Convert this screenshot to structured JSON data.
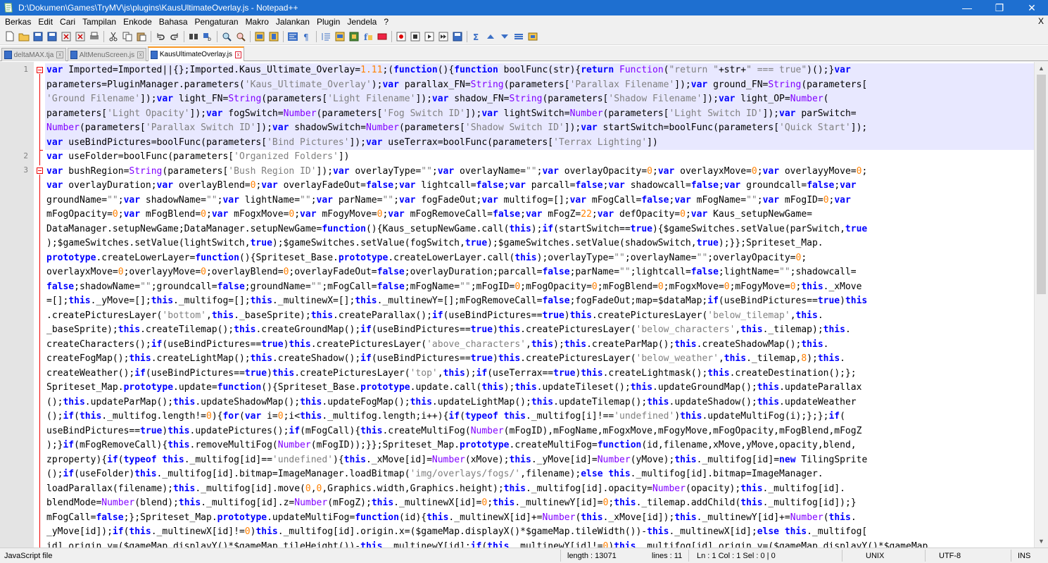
{
  "window": {
    "title": "D:\\Dokumen\\Games\\TryMV\\js\\plugins\\KausUltimateOverlay.js - Notepad++",
    "minimize": "—",
    "maximize": "❐",
    "close": "✕"
  },
  "menu": {
    "items": [
      "Berkas",
      "Edit",
      "Cari",
      "Tampilan",
      "Enkode",
      "Bahasa",
      "Pengaturan",
      "Makro",
      "Jalankan",
      "Plugin",
      "Jendela",
      "?"
    ],
    "close_label": "X"
  },
  "toolbar": {
    "icons": [
      "new-file-icon",
      "open-file-icon",
      "save-icon",
      "save-all-icon",
      "close-file-icon",
      "close-all-icon",
      "print-icon",
      "cut-icon",
      "copy-icon",
      "paste-icon",
      "undo-icon",
      "redo-icon",
      "find-icon",
      "replace-icon",
      "zoom-in-icon",
      "zoom-out-icon",
      "sync-vertical-icon",
      "sync-horizontal-icon",
      "word-wrap-icon",
      "show-all-chars-icon",
      "indent-guide-icon",
      "doc-map-icon",
      "function-list-icon",
      "folder-workspace-icon",
      "monitoring-icon",
      "record-macro-icon",
      "stop-macro-icon",
      "play-macro-icon",
      "run-macro-multiple-icon",
      "save-macro-icon",
      "sigma-icon",
      "up-arrow-icon",
      "down-arrow-icon",
      "compare-icon",
      "plugin-icon"
    ]
  },
  "tabs": [
    {
      "label": "deltaMAX.tja",
      "active": false
    },
    {
      "label": "AltMenuScreen.js",
      "active": false
    },
    {
      "label": "KausUltimateOverlay.js",
      "active": true
    }
  ],
  "editor": {
    "line_numbers": [
      "1",
      "2",
      "3"
    ],
    "code_lines": [
      "var Imported=Imported||{};Imported.Kaus_Ultimate_Overlay=1.11;(function(){function boolFunc(str){return Function(\"return \"+str+\" === true\")();}var",
      "parameters=PluginManager.parameters('Kaus_Ultimate_Overlay');var parallax_FN=String(parameters['Parallax Filename']);var ground_FN=String(parameters[",
      "'Ground Filename']);var light_FN=String(parameters['Light Filename']);var shadow_FN=String(parameters['Shadow Filename']);var light_OP=Number(",
      "parameters['Light Opacity']);var fogSwitch=Number(parameters['Fog Switch ID']);var lightSwitch=Number(parameters['Light Switch ID']);var parSwitch=",
      "Number(parameters['Parallax Switch ID']);var shadowSwitch=Number(parameters['Shadow Switch ID']);var startSwitch=boolFunc(parameters['Quick Start']);",
      "var useBindPictures=boolFunc(parameters['Bind Pictures']);var useTerrax=boolFunc(parameters['Terrax Lighting'])",
      "var useFolder=boolFunc(parameters['Organized Folders'])",
      "var bushRegion=String(parameters['Bush Region ID']);var overlayType=\"\";var overlayName=\"\";var overlayOpacity=0;var overlayxMove=0;var overlayyMove=0;",
      "var overlayDuration;var overlayBlend=0;var overlayFadeOut=false;var lightcall=false;var parcall=false;var shadowcall=false;var groundcall=false;var",
      "groundName=\"\";var shadowName=\"\";var lightName=\"\";var parName=\"\";var fogFadeOut;var multifog=[];var mFogCall=false;var mFogName=\"\";var mFogID=0;var",
      "mFogOpacity=0;var mFogBlend=0;var mFogxMove=0;var mFogyMove=0;var mFogRemoveCall=false;var mFogZ=22;var defOpacity=0;var Kaus_setupNewGame=",
      "DataManager.setupNewGame;DataManager.setupNewGame=function(){Kaus_setupNewGame.call(this);if(startSwitch==true){$gameSwitches.setValue(parSwitch,true",
      ");$gameSwitches.setValue(lightSwitch,true);$gameSwitches.setValue(fogSwitch,true);$gameSwitches.setValue(shadowSwitch,true);}};Spriteset_Map.",
      "prototype.createLowerLayer=function(){Spriteset_Base.prototype.createLowerLayer.call(this);overlayType=\"\";overlayName=\"\";overlayOpacity=0;",
      "overlayxMove=0;overlayyMove=0;overlayBlend=0;overlayFadeOut=false;overlayDuration;parcall=false;parName=\"\";lightcall=false;lightName=\"\";shadowcall=",
      "false;shadowName=\"\";groundcall=false;groundName=\"\";mFogCall=false;mFogName=\"\";mFogID=0;mFogOpacity=0;mFogBlend=0;mFogxMove=0;mFogyMove=0;this._xMove",
      "=[];this._yMove=[];this._multifog=[];this._multinewX=[];this._multinewY=[];mFogRemoveCall=false;fogFadeOut;map=$dataMap;if(useBindPictures==true)this",
      ".createPicturesLayer('bottom',this._baseSprite);this.createParallax();if(useBindPictures==true)this.createPicturesLayer('below_tilemap',this.",
      "_baseSprite);this.createTilemap();this.createGroundMap();if(useBindPictures==true)this.createPicturesLayer('below_characters',this._tilemap);this.",
      "createCharacters();if(useBindPictures==true)this.createPicturesLayer('above_characters',this);this.createParMap();this.createShadowMap();this.",
      "createFogMap();this.createLightMap();this.createShadow();if(useBindPictures==true)this.createPicturesLayer('below_weather',this._tilemap,8);this.",
      "createWeather();if(useBindPictures==true)this.createPicturesLayer('top',this);if(useTerrax==true)this.createLightmask();this.createDestination();};",
      "Spriteset_Map.prototype.update=function(){Spriteset_Base.prototype.update.call(this);this.updateTileset();this.updateGroundMap();this.updateParallax",
      "();this.updateParMap();this.updateShadowMap();this.updateFogMap();this.updateLightMap();this.updateTilemap();this.updateShadow();this.updateWeather",
      "();if(this._multifog.length!=0){for(var i=0;i<this._multifog.length;i++){if(typeof this._multifog[i]!=='undefined')this.updateMultiFog(i);};};if(",
      "useBindPictures==true)this.updatePictures();if(mFogCall){this.createMultiFog(Number(mFogID),mFogName,mFogxMove,mFogyMove,mFogOpacity,mFogBlend,mFogZ",
      ");}if(mFogRemoveCall){this.removeMultiFog(Number(mFogID));}};Spriteset_Map.prototype.createMultiFog=function(id,filename,xMove,yMove,opacity,blend,",
      "zproperty){if(typeof this._multifog[id]=='undefined'){this._xMove[id]=Number(xMove);this._yMove[id]=Number(yMove);this._multifog[id]=new TilingSprite",
      "();if(useFolder)this._multifog[id].bitmap=ImageManager.loadBitmap('img/overlays/fogs/',filename);else this._multifog[id].bitmap=ImageManager.",
      "loadParallax(filename);this._multifog[id].move(0,0,Graphics.width,Graphics.height);this._multifog[id].opacity=Number(opacity);this._multifog[id].",
      "blendMode=Number(blend);this._multifog[id].z=Number(mFogZ);this._multinewX[id]=0;this._multinewY[id]=0;this._tilemap.addChild(this._multifog[id]);}",
      "mFogCall=false;};Spriteset_Map.prototype.updateMultiFog=function(id){this._multinewX[id]+=Number(this._xMove[id]);this._multinewY[id]+=Number(this.",
      "_yMove[id]);if(this._multinewX[id]!=0)this._multifog[id].origin.x=($gameMap.displayX()*$gameMap.tileWidth())-this._multinewX[id];else this._multifog[",
      "id].origin.y=($gameMap.displayY()*$gameMap.tileHeight())-this._multinewY[id];if(this._multinewY[id]!=0)this._multifog[id].origin.y=($gameMap.displayY()*$gameMap."
    ]
  },
  "status": {
    "file_type": "JavaScript file",
    "length": "length : 13071",
    "lines": "lines : 11",
    "position": "Ln : 1    Col : 1    Sel : 0 | 0",
    "eol": "UNIX",
    "encoding": "UTF-8",
    "mode": "INS"
  },
  "colors": {
    "titlebar": "#1e6fd0",
    "keyword": "#0000ff",
    "type": "#8000ff",
    "string": "#808080",
    "number": "#ff8000",
    "current_line": "#e8e8ff"
  }
}
